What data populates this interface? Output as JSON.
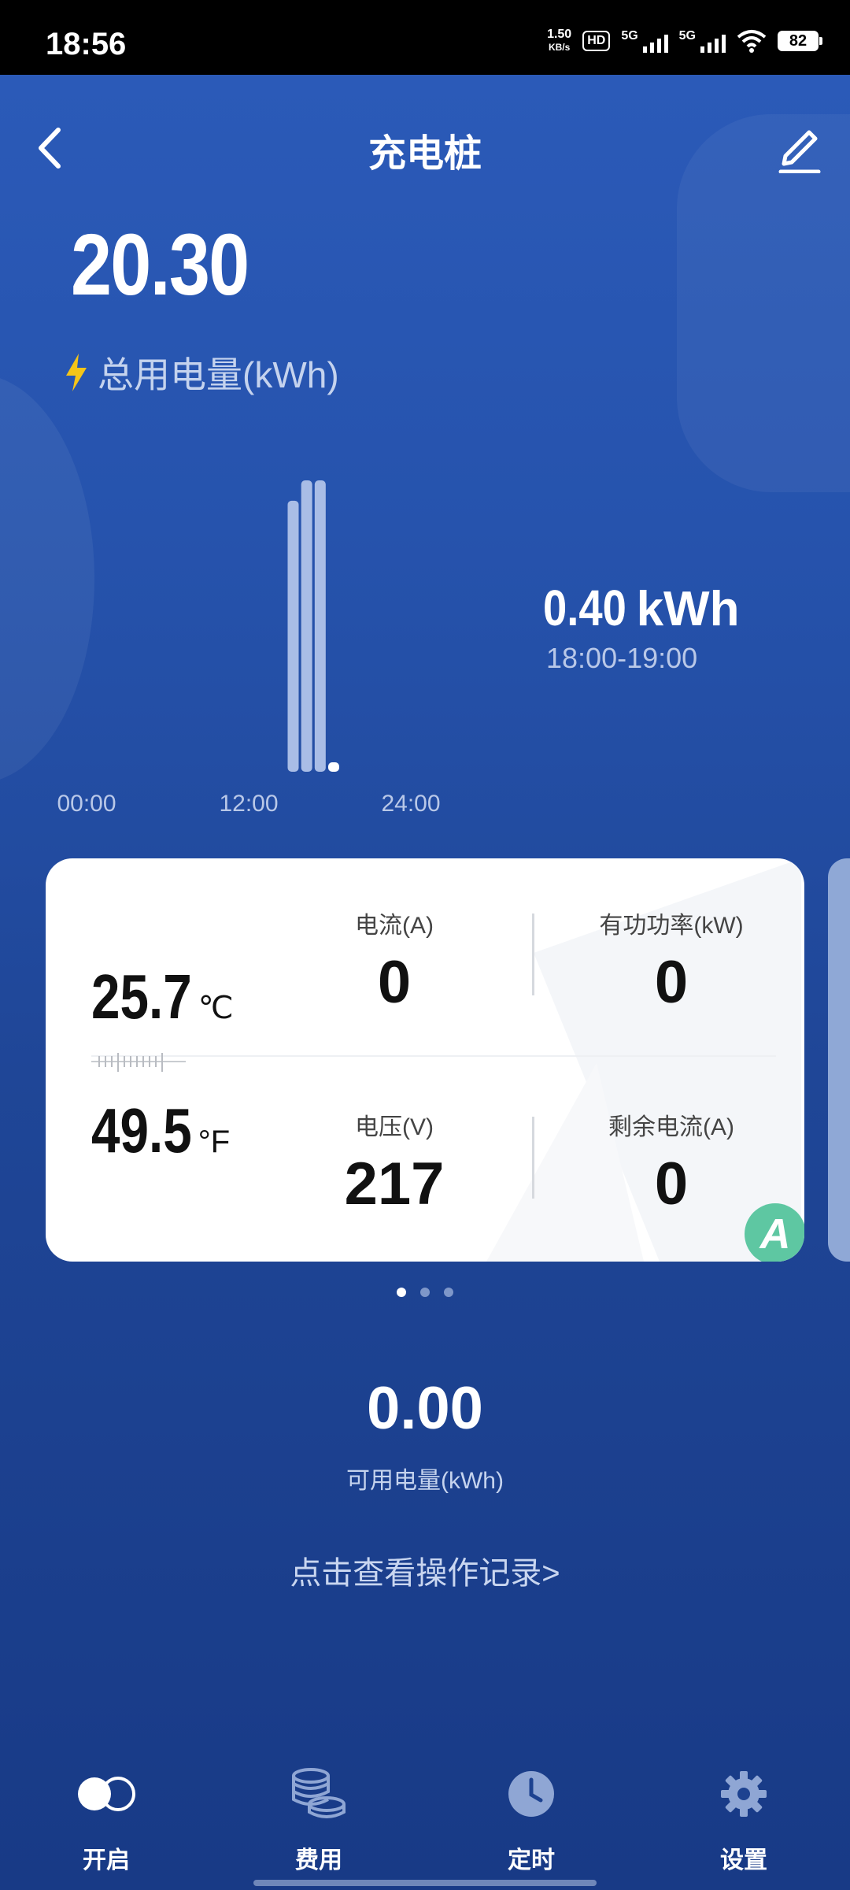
{
  "status_bar": {
    "time": "18:56",
    "net_speed": "1.50",
    "net_unit": "KB/s",
    "hd": "HD",
    "sim1": "5G",
    "sim2": "5G",
    "battery": "82"
  },
  "header": {
    "title": "充电桩"
  },
  "summary": {
    "total_value": "20.30",
    "total_label": "总用电量(kWh)"
  },
  "chart_data": {
    "type": "bar",
    "x_ticks": [
      "00:00",
      "12:00",
      "24:00"
    ],
    "bars": [
      {
        "hour": 15,
        "value": 20
      },
      {
        "hour": 16,
        "value": 21.5
      },
      {
        "hour": 17,
        "value": 21.5
      },
      {
        "hour": 18,
        "value": 0.4
      }
    ],
    "ylim": [
      0,
      21.5
    ],
    "selected": {
      "value": "0.40",
      "unit": "kWh",
      "range": "18:00-19:00"
    }
  },
  "card": {
    "temp_c": "25.7",
    "unit_c": "℃",
    "temp_f": "49.5",
    "unit_f": "°F",
    "current_label": "电流(A)",
    "current_value": "0",
    "power_label": "有功功率(kW)",
    "power_value": "0",
    "voltage_label": "电压(V)",
    "voltage_value": "217",
    "residual_label": "剩余电流(A)",
    "residual_value": "0",
    "badge": "A"
  },
  "available": {
    "value": "0.00",
    "label": "可用电量(kWh)"
  },
  "record_link": "点击查看操作记录>",
  "nav": {
    "on": "开启",
    "cost": "费用",
    "timer": "定时",
    "settings": "设置"
  }
}
